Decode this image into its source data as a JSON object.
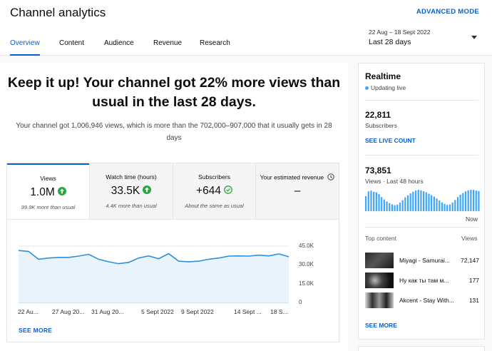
{
  "header": {
    "title": "Channel analytics",
    "advanced_mode": "ADVANCED MODE",
    "tabs": [
      {
        "label": "Overview",
        "active": true
      },
      {
        "label": "Content",
        "active": false
      },
      {
        "label": "Audience",
        "active": false
      },
      {
        "label": "Revenue",
        "active": false
      },
      {
        "label": "Research",
        "active": false
      }
    ],
    "date_range_sub": "22 Aug – 18 Sept 2022",
    "date_range_main": "Last 28 days"
  },
  "overview": {
    "headline_line1": "Keep it up! Your channel got 22% more views than",
    "headline_line2": "usual in the last 28 days.",
    "sub_line1": "Your channel got 1,006,946 views, which is more than the 702,000–907,000 that it usually gets in 28",
    "sub_line2": "days",
    "metrics": [
      {
        "label": "Views",
        "value": "1.0M",
        "note": "99.9K more than usual",
        "status": "up"
      },
      {
        "label": "Watch time (hours)",
        "value": "33.5K",
        "note": "4.4K more than usual",
        "status": "up"
      },
      {
        "label": "Subscribers",
        "value": "+644",
        "note": "About the same as usual",
        "status": "same"
      },
      {
        "label": "Your estimated revenue",
        "value": "–",
        "note": "",
        "status": "info"
      }
    ],
    "see_more": "SEE MORE"
  },
  "chart_data": {
    "type": "area",
    "x_tick_labels": [
      "22 Au...",
      "27 Aug 20...",
      "31 Aug 20...",
      "5 Sept 2022",
      "9 Sept 2022",
      "14 Sept ...",
      "18 S..."
    ],
    "y_tick_labels": [
      "45.0K",
      "30.0K",
      "15.0K",
      "0"
    ],
    "ylim": [
      0,
      45000
    ],
    "values": [
      41500,
      40800,
      34500,
      35500,
      36000,
      36000,
      37000,
      38500,
      34500,
      32500,
      31000,
      32000,
      35500,
      37200,
      35000,
      39000,
      33000,
      32500,
      33000,
      34500,
      35500,
      37000,
      37200,
      37000,
      37800,
      37200,
      38800,
      36500
    ],
    "accent": "#3ea6ff",
    "fill": "#e8f3fb",
    "grid": true
  },
  "realtime": {
    "title": "Realtime",
    "live_label": "Updating live",
    "subscribers_value": "22,811",
    "subscribers_label": "Subscribers",
    "see_live_count": "SEE LIVE COUNT",
    "views_value": "73,851",
    "views_label": "Views · Last 48 hours",
    "now_label": "Now",
    "bars": [
      0.62,
      0.82,
      0.85,
      0.8,
      0.78,
      0.7,
      0.58,
      0.48,
      0.4,
      0.33,
      0.28,
      0.25,
      0.27,
      0.35,
      0.45,
      0.57,
      0.65,
      0.73,
      0.8,
      0.85,
      0.88,
      0.86,
      0.82,
      0.78,
      0.72,
      0.66,
      0.6,
      0.52,
      0.44,
      0.36,
      0.3,
      0.26,
      0.28,
      0.36,
      0.46,
      0.58,
      0.68,
      0.75,
      0.82,
      0.86,
      0.88,
      0.88,
      0.85,
      0.83
    ],
    "top_content_label": "Top content",
    "top_content_views_label": "Views",
    "top_content": [
      {
        "title": "Miyagi - Samurai...",
        "views": "72,147"
      },
      {
        "title": "Ну как ты там м...",
        "views": "177"
      },
      {
        "title": "Akcent - Stay With...",
        "views": "131"
      }
    ],
    "see_more": "SEE MORE"
  },
  "colors": {
    "accent_blue": "#065fd4",
    "chart_line": "#3ea6ff",
    "up_green": "#2ba640",
    "background": "#f9f9f9"
  }
}
